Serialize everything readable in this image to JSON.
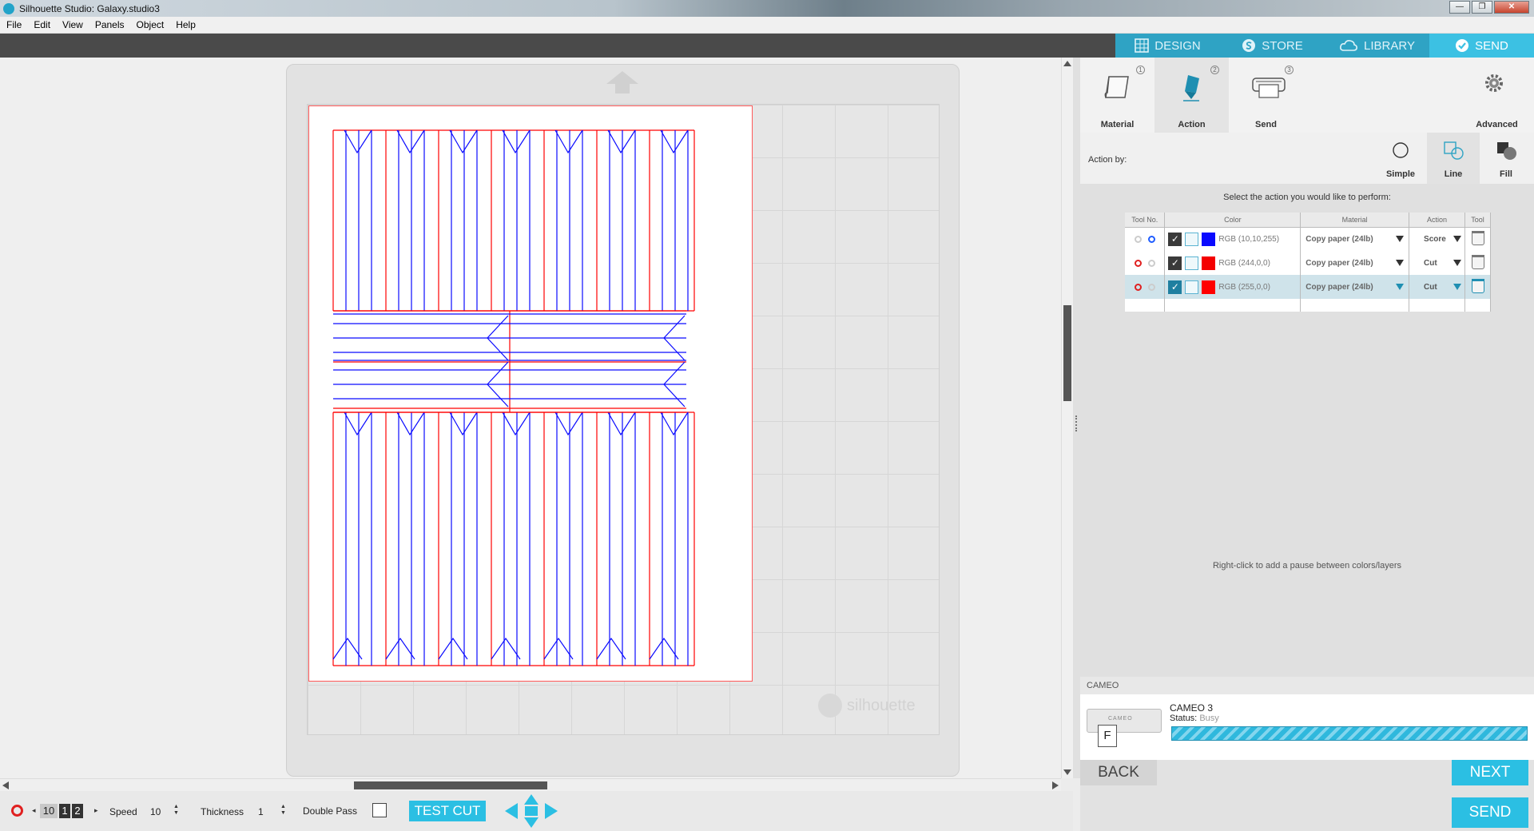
{
  "window": {
    "title": "Silhouette Studio: Galaxy.studio3"
  },
  "menu": [
    "File",
    "Edit",
    "View",
    "Panels",
    "Object",
    "Help"
  ],
  "nav": {
    "tabs": [
      {
        "label": "DESIGN",
        "icon": "grid-icon"
      },
      {
        "label": "STORE",
        "icon": "store-s-icon"
      },
      {
        "label": "LIBRARY",
        "icon": "cloud-icon"
      },
      {
        "label": "SEND",
        "icon": "check-circle-icon",
        "active": true
      }
    ]
  },
  "canvas": {
    "watermark": "silhouette"
  },
  "bottom_toolbar": {
    "pages": [
      "10",
      "1",
      "2"
    ],
    "speed_label": "Speed",
    "speed_value": "10",
    "thickness_label": "Thickness",
    "thickness_value": "1",
    "double_pass_label": "Double Pass",
    "test_cut_label": "TEST CUT"
  },
  "steps": [
    {
      "label": "Material",
      "num": "1",
      "icon": "material-icon"
    },
    {
      "label": "Action",
      "num": "2",
      "icon": "blade-icon",
      "active": true
    },
    {
      "label": "Send",
      "num": "3",
      "icon": "cutter-icon"
    },
    {
      "label": "Advanced",
      "icon": "gear-icon"
    }
  ],
  "action_by": {
    "label": "Action by:",
    "options": [
      "Simple",
      "Line",
      "Fill"
    ],
    "selected": "Line"
  },
  "table": {
    "prompt": "Select the action you would like to perform:",
    "headers": [
      "Tool No.",
      "Color",
      "Material",
      "Action",
      "Tool"
    ],
    "rows": [
      {
        "color_label": "RGB (10,10,255)",
        "swatch": "#0a0aff",
        "material": "Copy paper (24lb)",
        "action": "Score",
        "tool1": "empty",
        "tool2": "blue"
      },
      {
        "color_label": "RGB (244,0,0)",
        "swatch": "#f40000",
        "material": "Copy paper (24lb)",
        "action": "Cut",
        "tool1": "red",
        "tool2": "empty"
      },
      {
        "color_label": "RGB (255,0,0)",
        "swatch": "#ff0000",
        "material": "Copy paper (24lb)",
        "action": "Cut",
        "tool1": "red",
        "tool2": "empty",
        "selected": true
      }
    ],
    "hint": "Right-click to add a pause between colors/layers"
  },
  "device": {
    "section_label": "CAMEO",
    "name": "CAMEO 3",
    "status_label": "Status:",
    "status_value": "Busy",
    "device_text": "CAMEO",
    "badge": "F"
  },
  "buttons": {
    "back": "BACK",
    "next": "NEXT",
    "send": "SEND"
  },
  "colors": {
    "accent": "#2bbfe3",
    "cut_red": "#ff0000",
    "score_blue": "#0a0aff"
  }
}
